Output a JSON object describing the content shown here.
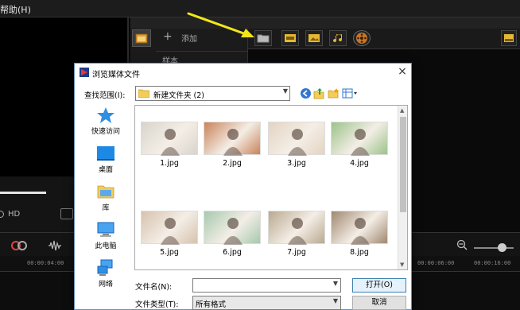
{
  "app": {
    "menu_help": "帮助(H)",
    "library": {
      "add_label": "添加",
      "sample_label": "样本"
    },
    "preview": {
      "quality_label": "HD"
    },
    "timeline": {
      "ticks": [
        "00:00:04:00",
        "00:00:06:00",
        "00:00:16:00"
      ]
    }
  },
  "dialog": {
    "title": "浏览媒体文件",
    "close": "×",
    "look_in_label": "查找范围(I):",
    "look_in_value": "新建文件夹 (2)",
    "places": [
      {
        "label": "快速访问",
        "icon": "star-icon"
      },
      {
        "label": "桌面",
        "icon": "desktop-icon"
      },
      {
        "label": "库",
        "icon": "library-icon"
      },
      {
        "label": "此电脑",
        "icon": "computer-icon"
      },
      {
        "label": "网络",
        "icon": "network-icon"
      }
    ],
    "files": [
      {
        "name": "1.jpg",
        "color": "#d8d4cc"
      },
      {
        "name": "2.jpg",
        "color": "#c9835a"
      },
      {
        "name": "3.jpg",
        "color": "#e3d4c2"
      },
      {
        "name": "4.jpg",
        "color": "#9cc38a"
      },
      {
        "name": "5.jpg",
        "color": "#d6c2ae"
      },
      {
        "name": "6.jpg",
        "color": "#a6c9ae"
      },
      {
        "name": "7.jpg",
        "color": "#b9a98f"
      },
      {
        "name": "8.jpg",
        "color": "#a08870"
      }
    ],
    "file_name_label": "文件名(N):",
    "file_name_value": "",
    "file_type_label": "文件类型(T):",
    "file_type_value": "所有格式",
    "open_button": "打开(O)",
    "cancel_button": "取消"
  },
  "colors": {
    "annotation_arrow": "#f2e61a",
    "open_button_border": "#3c7fb1",
    "dialog_border": "#6d8fb8"
  }
}
